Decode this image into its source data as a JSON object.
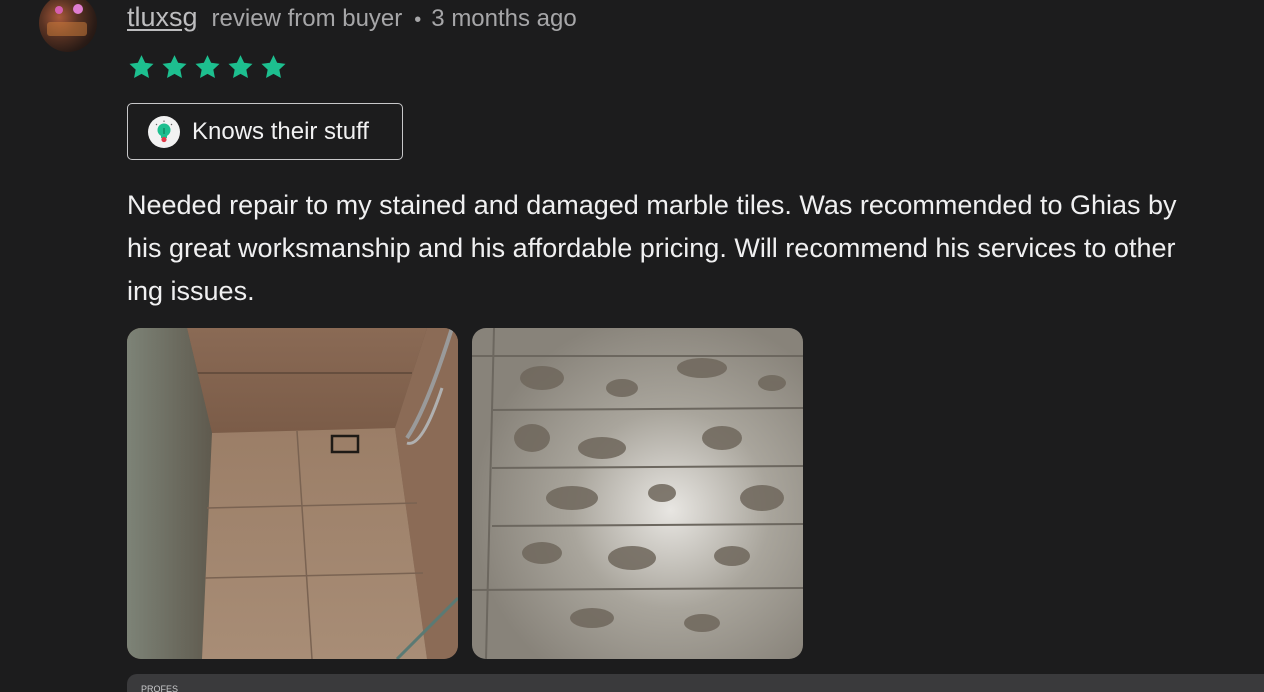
{
  "reviewer": {
    "name": "tluxsg",
    "review_type": "review from buyer",
    "separator": "•",
    "date": "3 months ago",
    "avatar_icon": "reviewer-avatar"
  },
  "rating": {
    "stars": 5,
    "max": 5,
    "star_color": "#1dbf8f"
  },
  "badge": {
    "label": "Knows their stuff",
    "icon": "lightbulb-icon"
  },
  "review_text": {
    "lines": [
      "Needed repair to my stained and damaged marble tiles. Was recommended to Ghias by",
      "his great worksmanship and his affordable pricing. Will recommend his services to other",
      "ing issues."
    ]
  },
  "photos": [
    {
      "name": "review-photo-1",
      "subject": "marble shower stall"
    },
    {
      "name": "review-photo-2",
      "subject": "stained marble floor"
    }
  ],
  "bottom_bar": {
    "label": "PROFES"
  }
}
